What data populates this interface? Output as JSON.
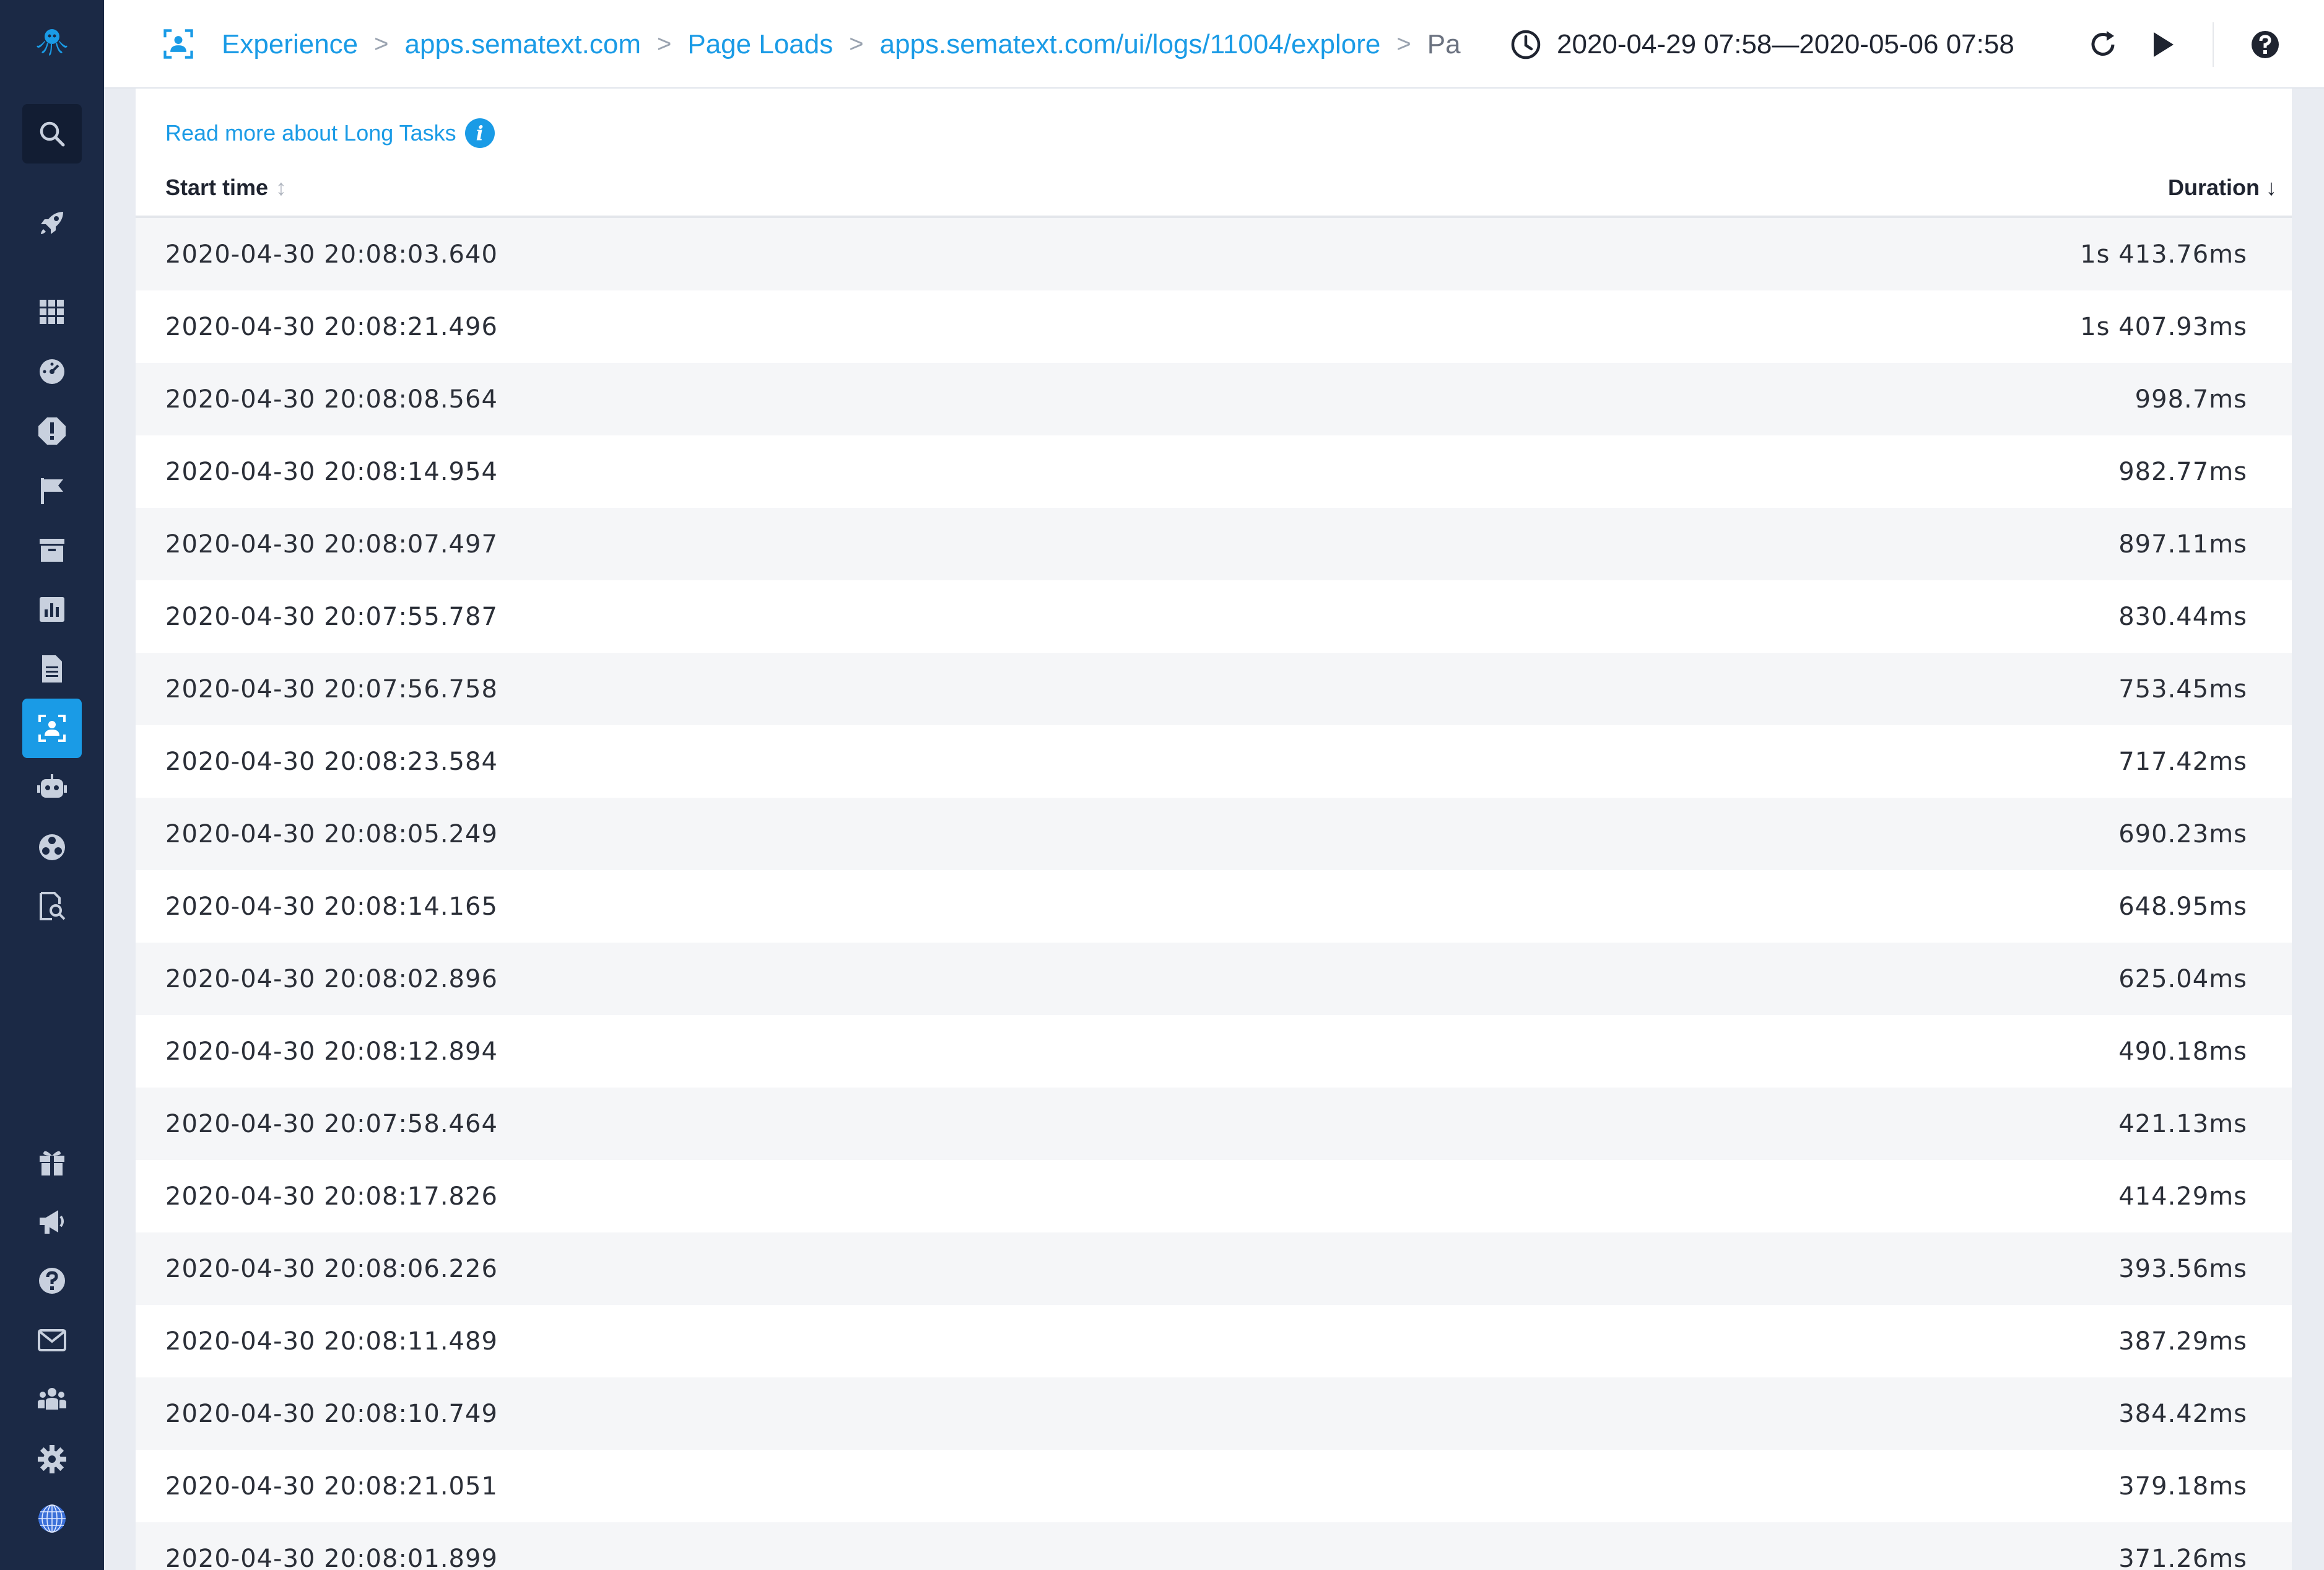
{
  "header": {
    "breadcrumb": {
      "items": [
        "Experience",
        "apps.sematext.com",
        "Page Loads",
        "apps.sematext.com/ui/logs/11004/explore",
        "Pa"
      ],
      "separator": ">"
    },
    "time_range": "2020-04-29 07:58—2020-05-06 07:58"
  },
  "sidebar": {
    "icons": [
      "octopus-logo",
      "search-icon",
      "rocket-icon",
      "apps-grid-icon",
      "dashboard-icon",
      "alert-icon",
      "flag-icon",
      "inbox-icon",
      "reports-icon",
      "logs-icon",
      "experience-icon",
      "bot-icon",
      "integrations-icon",
      "explore-icon",
      "gift-icon",
      "announcements-icon",
      "help-icon",
      "mail-icon",
      "team-icon",
      "settings-icon",
      "globe-avatar-icon"
    ],
    "active": "experience-icon"
  },
  "panel": {
    "read_more": "Read more about Long Tasks",
    "info_glyph": "i",
    "columns": {
      "start_time": "Start time",
      "duration": "Duration"
    },
    "rows": [
      {
        "start": "2020-04-30 20:08:03.640",
        "duration": "1s 413.76ms"
      },
      {
        "start": "2020-04-30 20:08:21.496",
        "duration": "1s 407.93ms"
      },
      {
        "start": "2020-04-30 20:08:08.564",
        "duration": "998.7ms"
      },
      {
        "start": "2020-04-30 20:08:14.954",
        "duration": "982.77ms"
      },
      {
        "start": "2020-04-30 20:08:07.497",
        "duration": "897.11ms"
      },
      {
        "start": "2020-04-30 20:07:55.787",
        "duration": "830.44ms"
      },
      {
        "start": "2020-04-30 20:07:56.758",
        "duration": "753.45ms"
      },
      {
        "start": "2020-04-30 20:08:23.584",
        "duration": "717.42ms"
      },
      {
        "start": "2020-04-30 20:08:05.249",
        "duration": "690.23ms"
      },
      {
        "start": "2020-04-30 20:08:14.165",
        "duration": "648.95ms"
      },
      {
        "start": "2020-04-30 20:08:02.896",
        "duration": "625.04ms"
      },
      {
        "start": "2020-04-30 20:08:12.894",
        "duration": "490.18ms"
      },
      {
        "start": "2020-04-30 20:07:58.464",
        "duration": "421.13ms"
      },
      {
        "start": "2020-04-30 20:08:17.826",
        "duration": "414.29ms"
      },
      {
        "start": "2020-04-30 20:08:06.226",
        "duration": "393.56ms"
      },
      {
        "start": "2020-04-30 20:08:11.489",
        "duration": "387.29ms"
      },
      {
        "start": "2020-04-30 20:08:10.749",
        "duration": "384.42ms"
      },
      {
        "start": "2020-04-30 20:08:21.051",
        "duration": "379.18ms"
      },
      {
        "start": "2020-04-30 20:08:01.899",
        "duration": "371.26ms"
      }
    ]
  },
  "colors": {
    "sidebar_bg": "#1b2945",
    "accent": "#1a9be6",
    "row_alt": "#f5f6f8",
    "page_bg": "#e9ecf2"
  }
}
